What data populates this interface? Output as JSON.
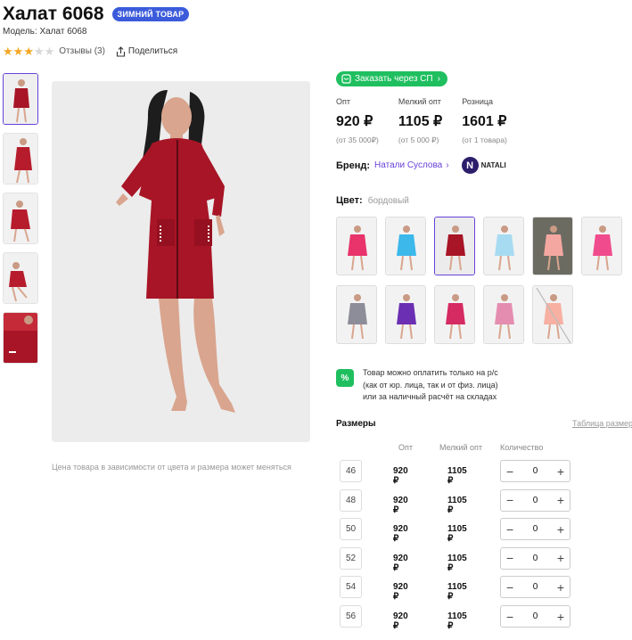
{
  "product": {
    "title": "Халат 6068",
    "badge": "ЗИМНИЙ ТОВАР",
    "model": "Модель: Халат 6068",
    "rating": 3,
    "rating_max": 5,
    "reviews": "Отзывы (3)",
    "share": "Поделиться"
  },
  "gallery": {
    "thumbs": [
      "thumb-1",
      "thumb-2",
      "thumb-3",
      "thumb-4",
      "thumb-5"
    ],
    "price_note": "Цена товара в зависимости от цвета и размера может меняться"
  },
  "order_button": "Заказать через СП",
  "prices": [
    {
      "label": "Опт",
      "value": "920 ₽",
      "min": "(от 35 000₽)"
    },
    {
      "label": "Мелкий опт",
      "value": "1105 ₽",
      "min": "(от 5 000 ₽)"
    },
    {
      "label": "Розница",
      "value": "1601 ₽",
      "min": "(от 1 товара)"
    }
  ],
  "brand": {
    "label": "Бренд:",
    "name": "Натали Суслова",
    "logo_text": "NATALI",
    "logo_letter": "N"
  },
  "color": {
    "label": "Цвет:",
    "value": "бордовый"
  },
  "swatches": [
    {
      "color": "#e8336b",
      "bg": "#f2f2f2"
    },
    {
      "color": "#3cb8ea",
      "bg": "#f2f2f2"
    },
    {
      "color": "#a81526",
      "bg": "#ececec"
    },
    {
      "color": "#a7dbf2",
      "bg": "#f2f2f2"
    },
    {
      "color": "#f3a7a0",
      "bg": "#6b6b62"
    },
    {
      "color": "#f04b8c",
      "bg": "#f2f2f2"
    },
    {
      "color": "#8d8d99",
      "bg": "#f2f2f2"
    },
    {
      "color": "#6b2fb3",
      "bg": "#f2f2f2"
    },
    {
      "color": "#d62a63",
      "bg": "#f2f2f2"
    },
    {
      "color": "#e58db1",
      "bg": "#f2f2f2"
    },
    {
      "color": "#f7b0a2",
      "bg": "#f2f2f2"
    }
  ],
  "payment_note": [
    "Товар можно оплатить только на р/с",
    "(как от юр. лица, так и от физ. лица)",
    "или за наличный расчёт на складах"
  ],
  "payment_icon": "%",
  "sizes": {
    "heading": "Размеры",
    "table_link": "Таблица размеров",
    "columns": [
      "Опт",
      "Мелкий опт",
      "Количество"
    ],
    "rows": [
      {
        "size": "46",
        "opt": "920 ₽",
        "small_opt": "1105 ₽",
        "qty": "0"
      },
      {
        "size": "48",
        "opt": "920 ₽",
        "small_opt": "1105 ₽",
        "qty": "0"
      },
      {
        "size": "50",
        "opt": "920 ₽",
        "small_opt": "1105 ₽",
        "qty": "0"
      },
      {
        "size": "52",
        "opt": "920 ₽",
        "small_opt": "1105 ₽",
        "qty": "0"
      },
      {
        "size": "54",
        "opt": "920 ₽",
        "small_opt": "1105 ₽",
        "qty": "0"
      },
      {
        "size": "56",
        "opt": "920 ₽",
        "small_opt": "1105 ₽",
        "qty": "0"
      }
    ]
  },
  "colors": {
    "accent": "#6741d9",
    "green": "#1fbf5f",
    "badge": "#3b5bdb",
    "product": "#a81526"
  }
}
